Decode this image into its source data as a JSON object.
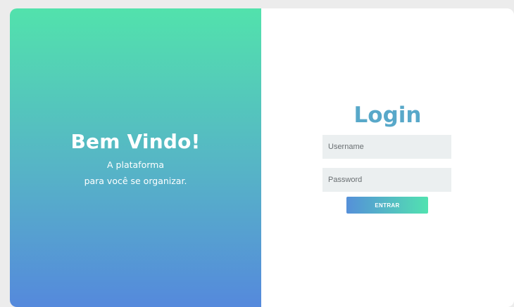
{
  "welcome": {
    "title": "Bem Vindo!",
    "line1": "A plataforma",
    "line2": "para você se organizar."
  },
  "login": {
    "title": "Login",
    "username_placeholder": "Username",
    "password_placeholder": "Password",
    "enter_label": "ENTRAR"
  },
  "colors": {
    "gradient_top": "#52e2ac",
    "gradient_bottom": "#5589dc",
    "title_color": "#58a8c9",
    "input_bg": "#ebeff0"
  }
}
